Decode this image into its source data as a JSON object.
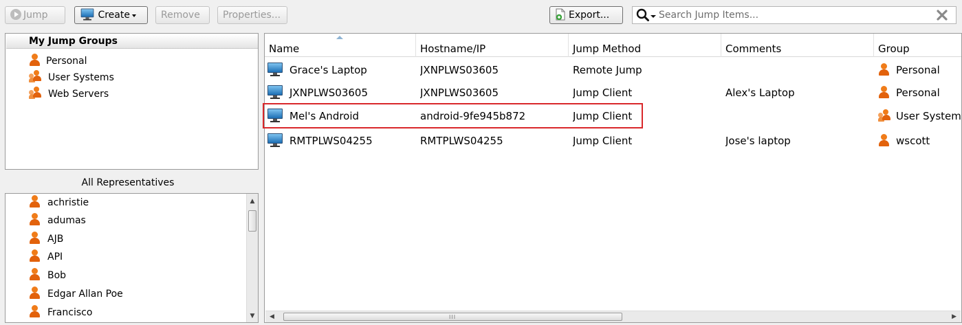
{
  "toolbar": {
    "jump_label": "Jump",
    "create_label": "Create",
    "remove_label": "Remove",
    "properties_label": "Properties...",
    "export_label": "Export..."
  },
  "search": {
    "placeholder": "Search Jump Items...",
    "value": ""
  },
  "groups": {
    "header": "My Jump Groups",
    "items": [
      {
        "label": "Personal",
        "icon": "person-icon"
      },
      {
        "label": "User Systems",
        "icon": "group-icon"
      },
      {
        "label": "Web Servers",
        "icon": "group-icon"
      }
    ]
  },
  "representatives": {
    "title": "All Representatives",
    "items": [
      "achristie",
      "adumas",
      "AJB",
      "API",
      "Bob",
      "Edgar Allan Poe",
      "Francisco"
    ]
  },
  "table": {
    "columns": [
      "Name",
      "Hostname/IP",
      "Jump Method",
      "Comments",
      "Group"
    ],
    "rows": [
      {
        "name": "Grace's Laptop",
        "host": "JXNPLWS03605",
        "method": "Remote Jump",
        "comments": "",
        "group": "Personal",
        "group_icon": "person-icon"
      },
      {
        "name": "JXNPLWS03605",
        "host": "JXNPLWS03605",
        "method": "Jump Client",
        "comments": "Alex's Laptop",
        "group": "Personal",
        "group_icon": "person-icon"
      },
      {
        "name": "Mel's Android",
        "host": "android-9fe945b872",
        "method": "Jump Client",
        "comments": "",
        "group": "User System",
        "group_icon": "group-icon"
      },
      {
        "name": "RMTPLWS04255",
        "host": "RMTPLWS04255",
        "method": "Jump Client",
        "comments": "Jose's laptop",
        "group": "wscott",
        "group_icon": "person-icon"
      }
    ],
    "highlighted_row": 2
  },
  "colors": {
    "highlight_border": "#d9272a",
    "person_icon": "#f07c19",
    "monitor_icon": "#1c6fb5"
  },
  "scroll_glyphs": {
    "hgrip": "III"
  }
}
